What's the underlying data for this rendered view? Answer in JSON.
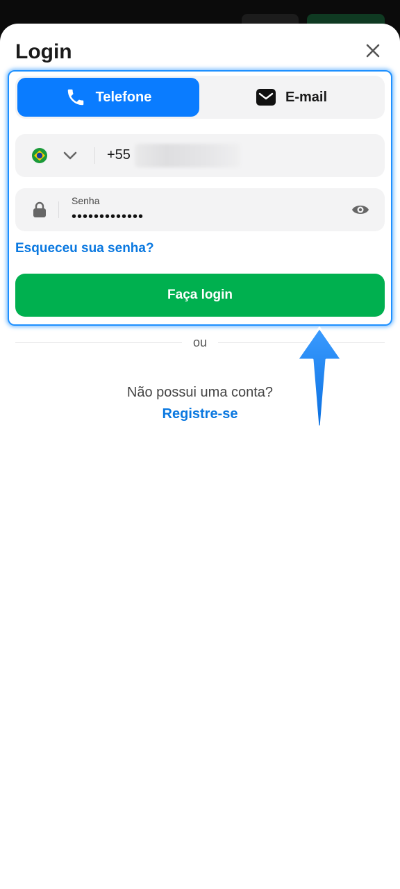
{
  "dialog": {
    "title": "Login"
  },
  "tabs": [
    {
      "label": "Telefone",
      "icon": "phone-icon",
      "active": true
    },
    {
      "label": "E-mail",
      "icon": "mail-icon",
      "active": false
    }
  ],
  "phone_field": {
    "country_icon": "brazil-flag-icon",
    "prefix": "+55"
  },
  "password_field": {
    "label": "Senha",
    "value": "•••••••••••••"
  },
  "links": {
    "forgot": "Esqueceu sua senha?",
    "register": "Registre-se"
  },
  "actions": {
    "login_label": "Faça login"
  },
  "divider": {
    "text": "ou"
  },
  "signup": {
    "question": "Não possui uma conta?"
  },
  "colors": {
    "accent_blue": "#0a7cff",
    "login_green": "#00b04f",
    "link_blue": "#0a78e0"
  }
}
